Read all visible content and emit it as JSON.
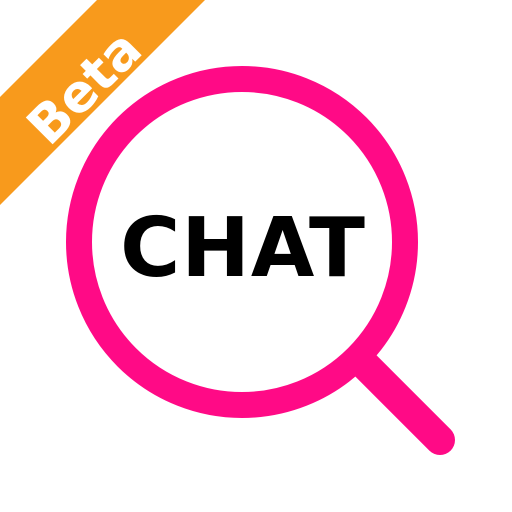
{
  "icon": {
    "badge_label": "Beta",
    "center_label": "CHAT",
    "colors": {
      "background": "#ffffff",
      "ring": "#ff0a86",
      "badge": "#f89a1c",
      "badge_text": "#ffffff",
      "center_text": "#000000"
    },
    "glyph": "magnifier-icon"
  }
}
